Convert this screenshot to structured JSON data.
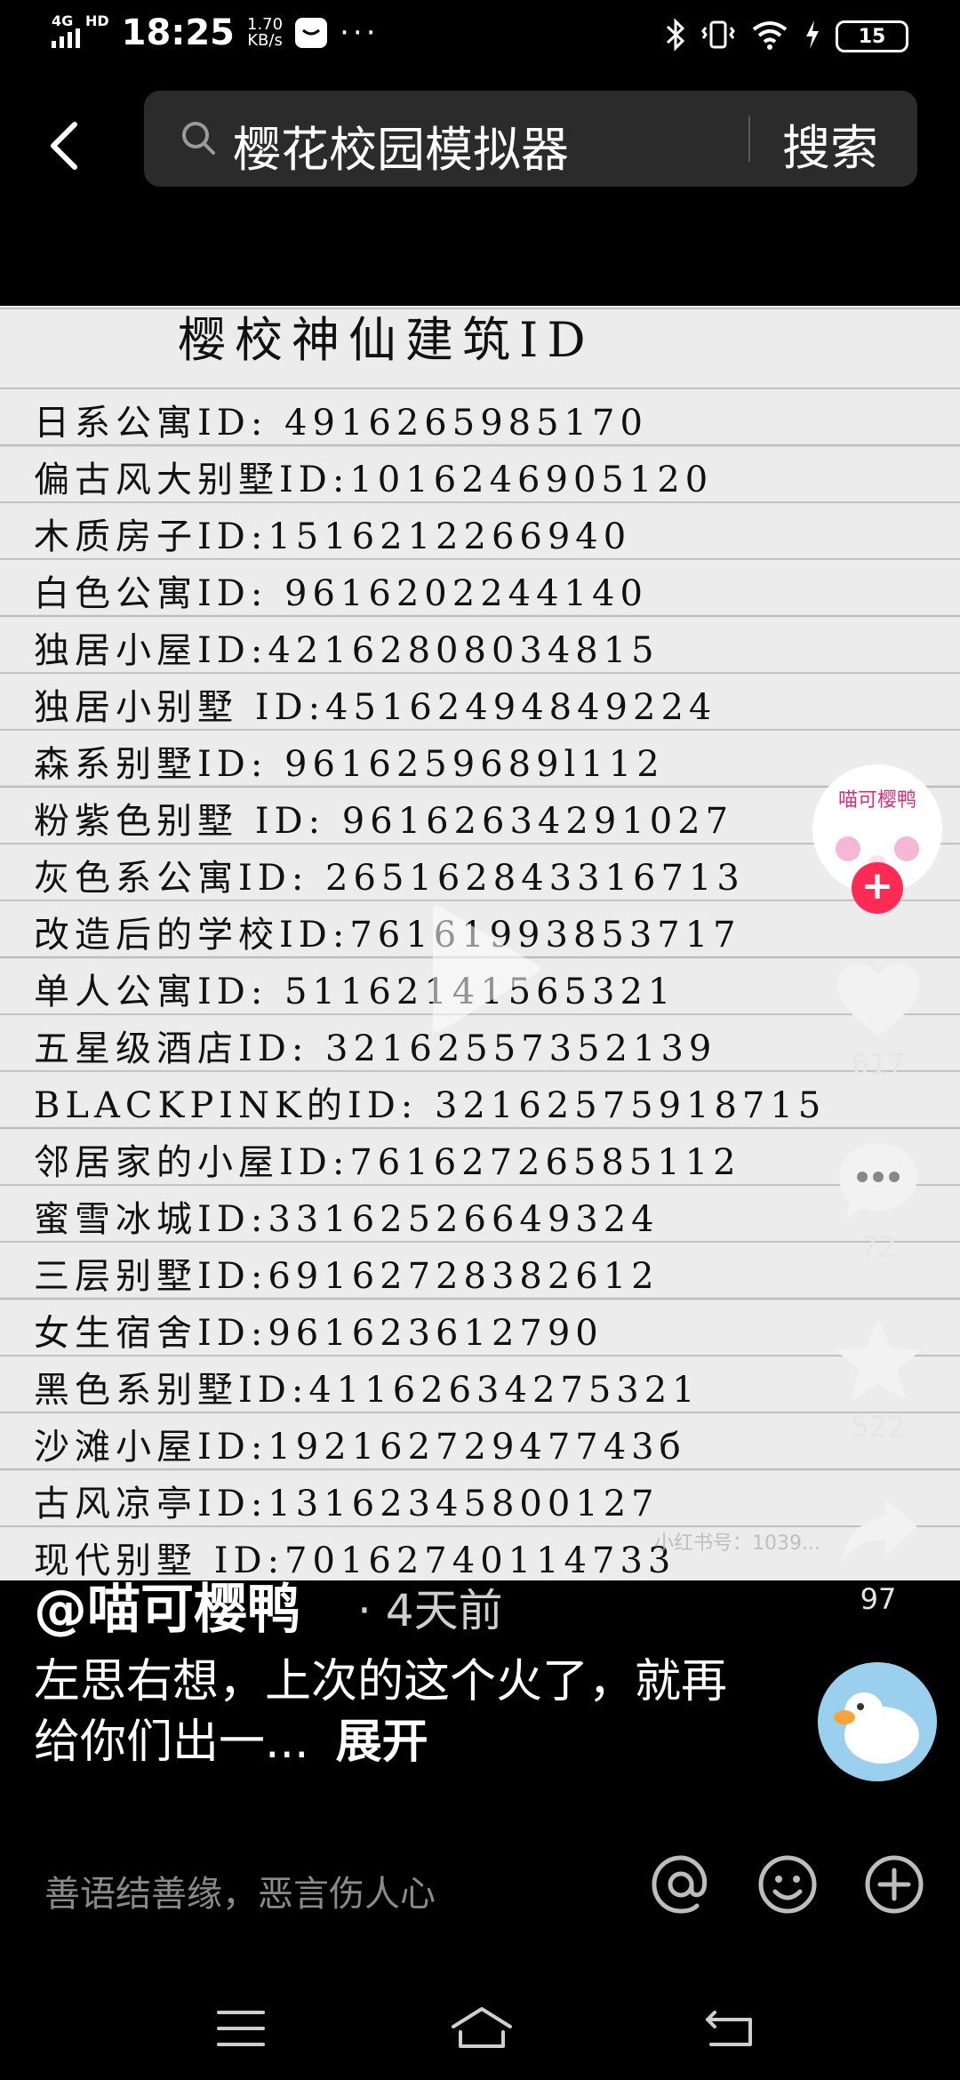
{
  "status_bar": {
    "network_type": "4G",
    "network_suffix": "HD",
    "time": "18:25",
    "speed_value": "1.70",
    "speed_unit": "KB/s",
    "notification_dots": "···",
    "battery_level": "15"
  },
  "search": {
    "query": "樱花校园模拟器",
    "button_label": "搜索"
  },
  "note": {
    "title": "樱校神仙建筑ID",
    "lines": [
      "日系公寓ID: 4916265985170",
      "偏古风大别墅ID:1016246905120",
      "木质房子ID:1516212266940",
      "白色公寓ID: 9616202244140",
      "独居小屋ID:42162808034815",
      "独居小别墅 ID:45162494849224",
      "森系别墅ID: 9616259689l112",
      "粉紫色别墅 ID: 96162634291027",
      "灰色系公寓ID: 265162843316713",
      "改造后的学校ID:76161993853717",
      "单人公寓ID: 51162141565321",
      "五星级酒店ID: 32162557352139",
      "BLACKPINK的ID: 32162575918715",
      "邻居家的小屋ID:76162726585112",
      "蜜雪冰城ID:33162526649324",
      "三层别墅ID:69162728382612",
      "女生宿舍ID:961623612790",
      "黑色系别墅ID:41162634275321",
      "沙滩小屋ID:19216272947743б",
      "古风凉亭ID:13162345800127",
      "现代别墅 ID:70162740114733"
    ],
    "watermark": "小红书号：1039..."
  },
  "actions": {
    "creator_avatar_text": "喵可樱鸭",
    "likes": "617",
    "comments": "72",
    "favorites": "522",
    "shares": "97"
  },
  "post": {
    "author": "@喵可樱鸭",
    "time_ago": "· 4天前",
    "description": "左思右想，上次的这个火了，就再给你们出一...",
    "expand_label": "展开"
  },
  "comment_bar": {
    "placeholder": "善语结善缘，恶言伤人心"
  },
  "icons": {
    "like": "heart-icon",
    "comment": "speech-bubble-icon",
    "favorite": "star-icon",
    "share": "share-arrow-icon"
  }
}
